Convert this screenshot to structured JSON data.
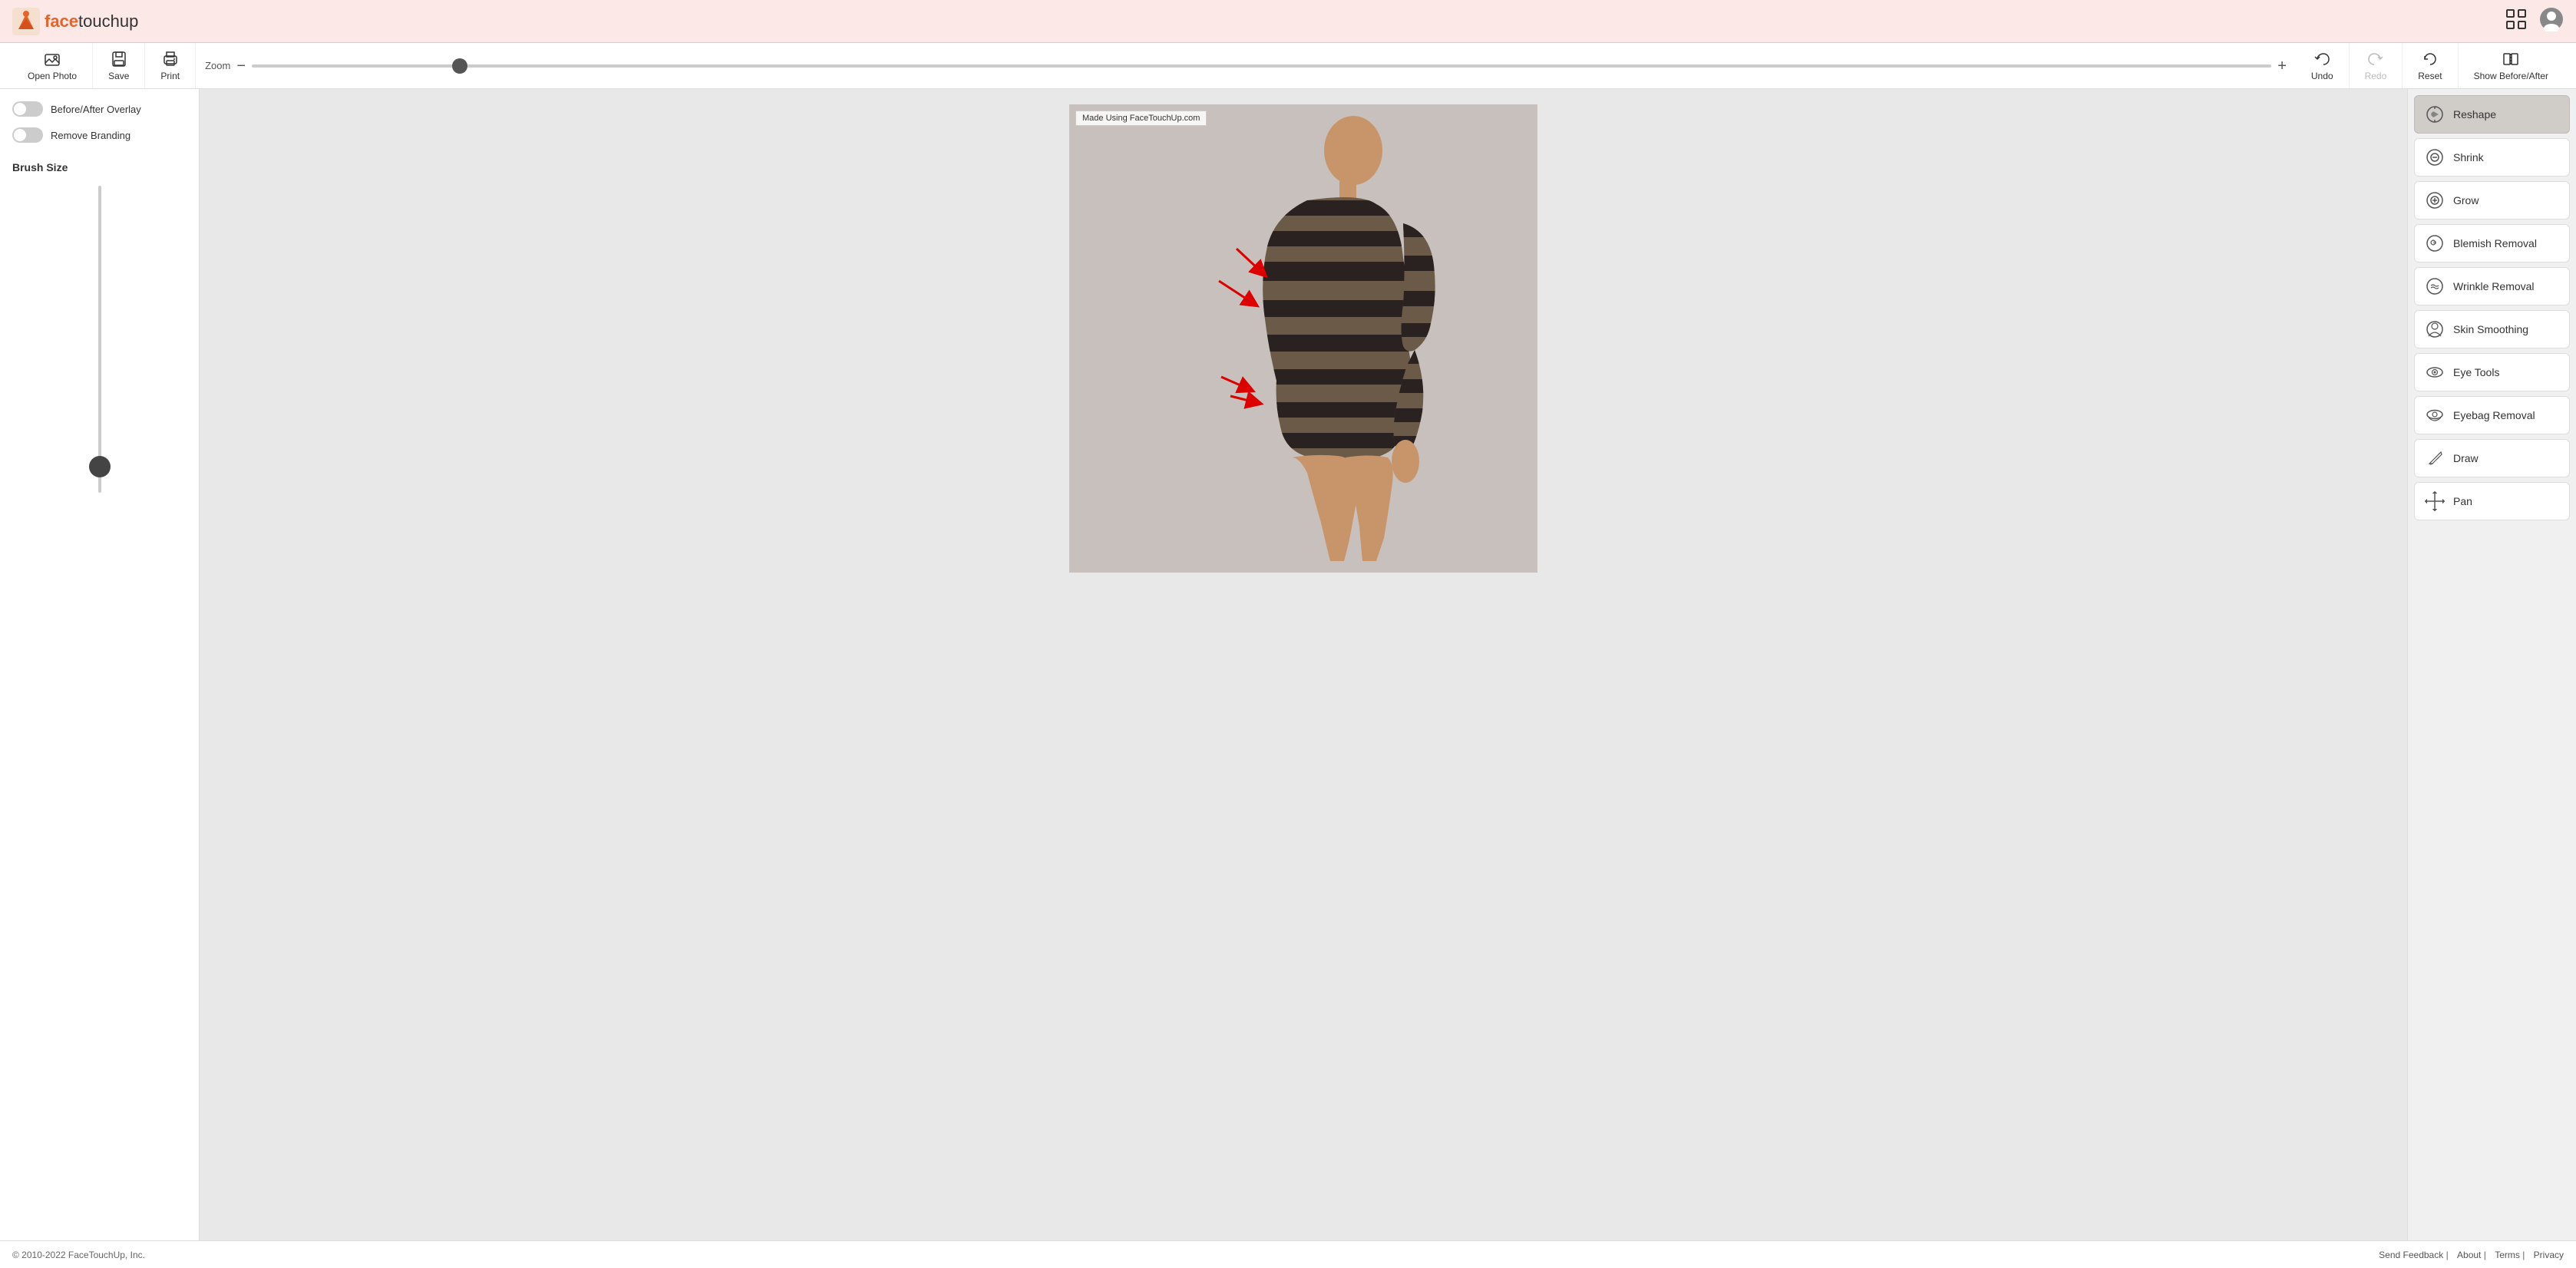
{
  "header": {
    "logo_face": "face",
    "logo_touchup": "touchup",
    "logo_alt": "FaceTouchUp logo"
  },
  "toolbar": {
    "open_photo_label": "Open Photo",
    "save_label": "Save",
    "print_label": "Print",
    "zoom_label": "Zoom",
    "zoom_value": 50,
    "undo_label": "Undo",
    "redo_label": "Redo",
    "reset_label": "Reset",
    "show_before_after_label": "Show Before/After"
  },
  "left_panel": {
    "before_after_overlay_label": "Before/After Overlay",
    "remove_branding_label": "Remove Branding",
    "brush_size_label": "Brush Size"
  },
  "watermark": {
    "text": "Made Using FaceTouchUp.com"
  },
  "right_panel": {
    "tools": [
      {
        "id": "reshape",
        "label": "Reshape",
        "icon": "reshape-icon",
        "active": true
      },
      {
        "id": "shrink",
        "label": "Shrink",
        "icon": "shrink-icon",
        "active": false
      },
      {
        "id": "grow",
        "label": "Grow",
        "icon": "grow-icon",
        "active": false
      },
      {
        "id": "blemish-removal",
        "label": "Blemish Removal",
        "icon": "blemish-icon",
        "active": false
      },
      {
        "id": "wrinkle-removal",
        "label": "Wrinkle Removal",
        "icon": "wrinkle-icon",
        "active": false
      },
      {
        "id": "skin-smoothing",
        "label": "Skin Smoothing",
        "icon": "skin-icon",
        "active": false
      },
      {
        "id": "eye-tools",
        "label": "Eye Tools",
        "icon": "eye-icon",
        "active": false
      },
      {
        "id": "eyebag-removal",
        "label": "Eyebag Removal",
        "icon": "eyebag-icon",
        "active": false
      },
      {
        "id": "draw",
        "label": "Draw",
        "icon": "draw-icon",
        "active": false
      },
      {
        "id": "pan",
        "label": "Pan",
        "icon": "pan-icon",
        "active": false
      }
    ]
  },
  "footer": {
    "copyright": "© 2010-2022 FaceTouchUp, Inc.",
    "links": [
      {
        "label": "Send Feedback"
      },
      {
        "label": "About"
      },
      {
        "label": "Terms"
      },
      {
        "label": "Privacy"
      }
    ]
  }
}
